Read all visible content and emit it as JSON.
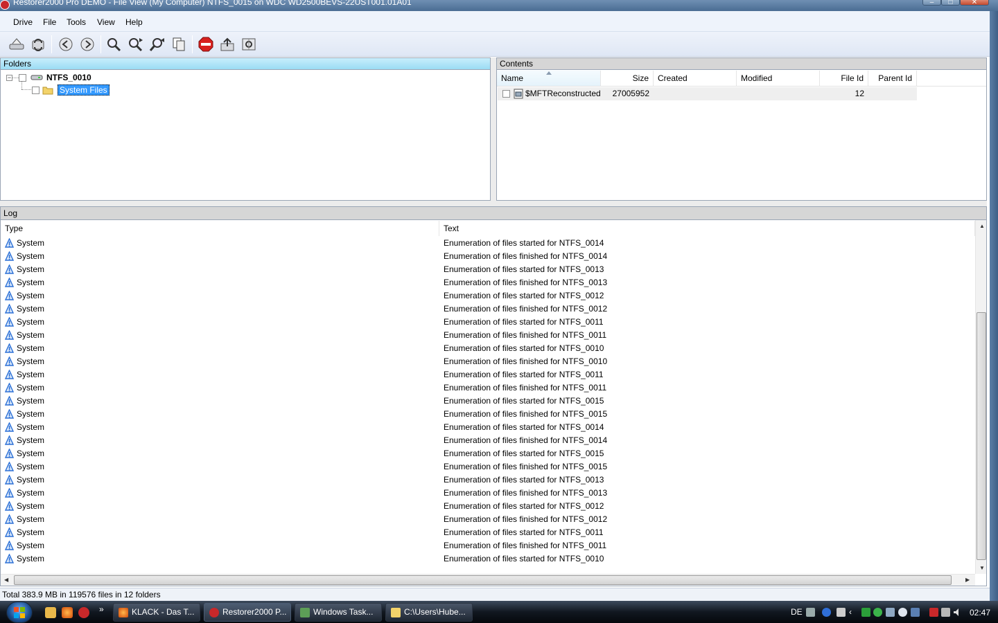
{
  "window": {
    "title": "Restorer2000 Pro DEMO - File View (My Computer) NTFS_0015 on WDC WD2500BEVS-22UST001.01A01"
  },
  "menu": {
    "items": [
      "Drive",
      "File",
      "Tools",
      "View",
      "Help"
    ]
  },
  "toolbar": {
    "icons": [
      "drive-icon",
      "refresh-icon",
      "back-icon",
      "forward-icon",
      "search-icon",
      "find-next-icon",
      "find-previous-icon",
      "copy-icon",
      "stop-icon",
      "export-icon",
      "properties-icon"
    ]
  },
  "folders": {
    "header": "Folders",
    "tree": {
      "root": "NTFS_0010",
      "child": "System Files"
    }
  },
  "contents": {
    "header": "Contents",
    "columns": [
      "Name",
      "Size",
      "Created",
      "Modified",
      "File Id",
      "Parent Id"
    ],
    "rows": [
      {
        "name": "$MFTReconstructed",
        "size": "27005952",
        "created": "",
        "modified": "",
        "file_id": "12",
        "parent_id": ""
      }
    ]
  },
  "log": {
    "header": "Log",
    "columns": [
      "Type",
      "Text"
    ],
    "rows": [
      {
        "type": "System",
        "text": "Enumeration of files started for NTFS_0014"
      },
      {
        "type": "System",
        "text": "Enumeration of files finished for NTFS_0014"
      },
      {
        "type": "System",
        "text": "Enumeration of files started for NTFS_0013"
      },
      {
        "type": "System",
        "text": "Enumeration of files finished for NTFS_0013"
      },
      {
        "type": "System",
        "text": "Enumeration of files started for NTFS_0012"
      },
      {
        "type": "System",
        "text": "Enumeration of files finished for NTFS_0012"
      },
      {
        "type": "System",
        "text": "Enumeration of files started for NTFS_0011"
      },
      {
        "type": "System",
        "text": "Enumeration of files finished for NTFS_0011"
      },
      {
        "type": "System",
        "text": "Enumeration of files started for NTFS_0010"
      },
      {
        "type": "System",
        "text": "Enumeration of files finished for NTFS_0010"
      },
      {
        "type": "System",
        "text": "Enumeration of files started for NTFS_0011"
      },
      {
        "type": "System",
        "text": "Enumeration of files finished for NTFS_0011"
      },
      {
        "type": "System",
        "text": "Enumeration of files started for NTFS_0015"
      },
      {
        "type": "System",
        "text": "Enumeration of files finished for NTFS_0015"
      },
      {
        "type": "System",
        "text": "Enumeration of files started for NTFS_0014"
      },
      {
        "type": "System",
        "text": "Enumeration of files finished for NTFS_0014"
      },
      {
        "type": "System",
        "text": "Enumeration of files started for NTFS_0015"
      },
      {
        "type": "System",
        "text": "Enumeration of files finished for NTFS_0015"
      },
      {
        "type": "System",
        "text": "Enumeration of files started for NTFS_0013"
      },
      {
        "type": "System",
        "text": "Enumeration of files finished for NTFS_0013"
      },
      {
        "type": "System",
        "text": "Enumeration of files started for NTFS_0012"
      },
      {
        "type": "System",
        "text": "Enumeration of files finished for NTFS_0012"
      },
      {
        "type": "System",
        "text": "Enumeration of files started for NTFS_0011"
      },
      {
        "type": "System",
        "text": "Enumeration of files finished for NTFS_0011"
      },
      {
        "type": "System",
        "text": "Enumeration of files started for NTFS_0010"
      }
    ]
  },
  "status": {
    "text": "Total 383.9 MB in 119576 files in 12 folders"
  },
  "taskbar": {
    "tasks": [
      {
        "label": "KLACK - Das T...",
        "icon": "firefox-icon"
      },
      {
        "label": "Restorer2000 P...",
        "icon": "restorer-icon"
      },
      {
        "label": "Windows Task...",
        "icon": "task-manager-icon"
      },
      {
        "label": "C:\\Users\\Hube...",
        "icon": "folder-icon"
      }
    ],
    "quicklaunch_more": "»",
    "language": "DE",
    "clock": "02:47"
  },
  "colors": {
    "selection": "#3399ff",
    "folders_header": "#9bdcf4",
    "log_icon": "#2a6fd6"
  }
}
